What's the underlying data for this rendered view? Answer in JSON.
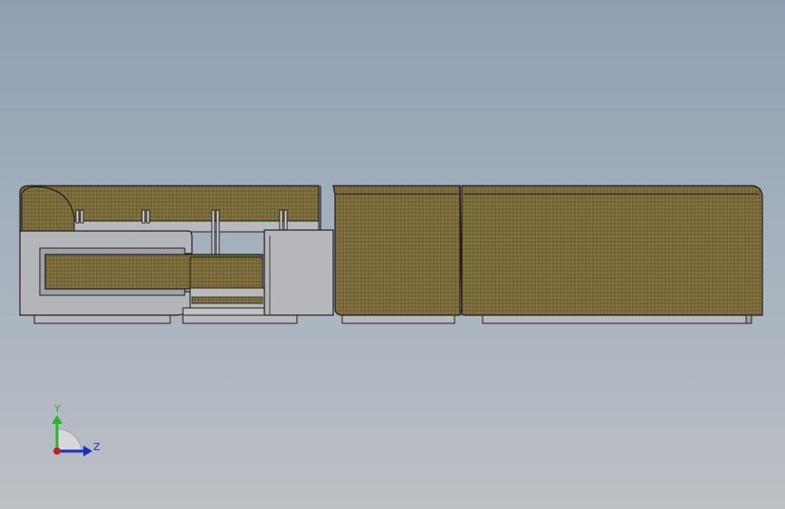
{
  "viewport": {
    "background_top": "#8f9fb3",
    "background_bottom": "#bcc0c5"
  },
  "model": {
    "fabric_color": "#7a6a3a",
    "frame_color": "#b3b5b8",
    "outline_color": "#1e1e1e"
  },
  "triad": {
    "y_label": "Y",
    "z_label": "Z",
    "y_color": "#2bb52b",
    "z_color": "#1d2fc9",
    "x_color": "#c81e1e"
  }
}
